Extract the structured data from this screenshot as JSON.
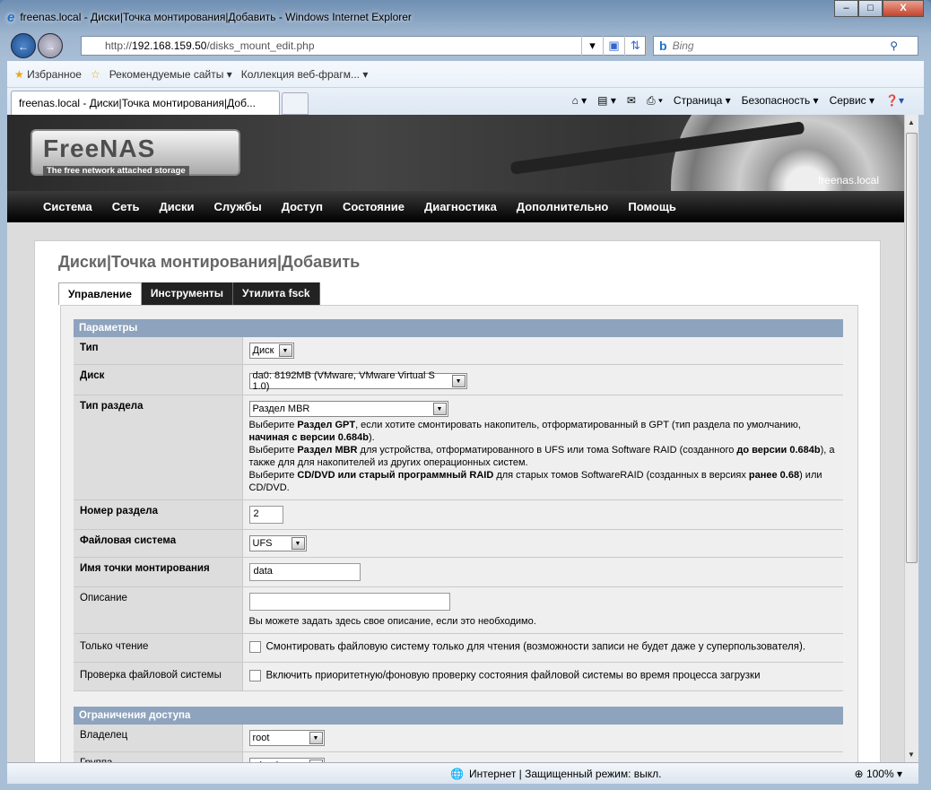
{
  "window": {
    "title": "freenas.local - Диски|Точка монтирования|Добавить - Windows Internet Explorer"
  },
  "address": {
    "prefix": "http://",
    "host": "192.168.159.50",
    "path": "/disks_mount_edit.php",
    "search_placeholder": "Bing"
  },
  "favorites": {
    "label": "Избранное",
    "items": [
      "Рекомендуемые сайты ▾",
      "Коллекция веб-фрагм... ▾"
    ]
  },
  "tab": {
    "label": "freenas.local - Диски|Точка монтирования|Доб..."
  },
  "commands": [
    "Страница ▾",
    "Безопасность ▾",
    "Сервис ▾"
  ],
  "site": {
    "logo": "FreeNAS",
    "tagline": "The free network attached storage",
    "hostname": "freenas.local",
    "menu": [
      "Система",
      "Сеть",
      "Диски",
      "Службы",
      "Доступ",
      "Состояние",
      "Диагностика",
      "Дополнительно",
      "Помощь"
    ]
  },
  "page": {
    "title": "Диски|Точка монтирования|Добавить",
    "tabs": [
      "Управление",
      "Инструменты",
      "Утилита fsck"
    ]
  },
  "form": {
    "section1": "Параметры",
    "type": {
      "label": "Тип",
      "value": "Диск"
    },
    "disk": {
      "label": "Диск",
      "value": "da0: 8192MB (VMware, VMware Virtual S 1.0)"
    },
    "parttype": {
      "label": "Тип раздела",
      "value": "Раздел MBR",
      "h1a": "Выберите ",
      "h1b": "Раздел GPT",
      "h1c": ", если хотите смонтировать накопитель, отформатированный в GPT (тип раздела по умолчанию, ",
      "h1d": "начиная с версии 0.684b",
      "h1e": ").",
      "h2a": "Выберите ",
      "h2b": "Раздел MBR",
      "h2c": " для устройства, отформатированного в UFS или тома Software RAID (созданного ",
      "h2d": "до версии 0.684b",
      "h2e": "), а также для для накопителей из других операционных систем.",
      "h3a": "Выберите ",
      "h3b": "CD/DVD или старый программный RAID",
      "h3c": " для старых томов SoftwareRAID (созданных в версиях ",
      "h3d": "ранее 0.68",
      "h3e": ") или CD/DVD."
    },
    "partnum": {
      "label": "Номер раздела",
      "value": "2"
    },
    "fs": {
      "label": "Файловая система",
      "value": "UFS"
    },
    "mountname": {
      "label": "Имя точки монтирования",
      "value": "data"
    },
    "desc": {
      "label": "Описание",
      "value": "",
      "hint": "Вы можете задать здесь свое описание, если это необходимо."
    },
    "readonly": {
      "label": "Только чтение",
      "text": "Смонтировать файловую систему только для чтения (возможности записи не будет даже у суперпользователя)."
    },
    "fsck": {
      "label": "Проверка файловой системы",
      "text": "Включить приоритетную/фоновую проверку состояния файловой системы во время процесса загрузки"
    },
    "section2": "Ограничения доступа",
    "owner": {
      "label": "Владелец",
      "value": "root"
    },
    "group": {
      "label": "Группа",
      "value": "wheel"
    }
  },
  "status": {
    "zone": "Интернет | Защищенный режим: выкл.",
    "zoom": "100%"
  }
}
